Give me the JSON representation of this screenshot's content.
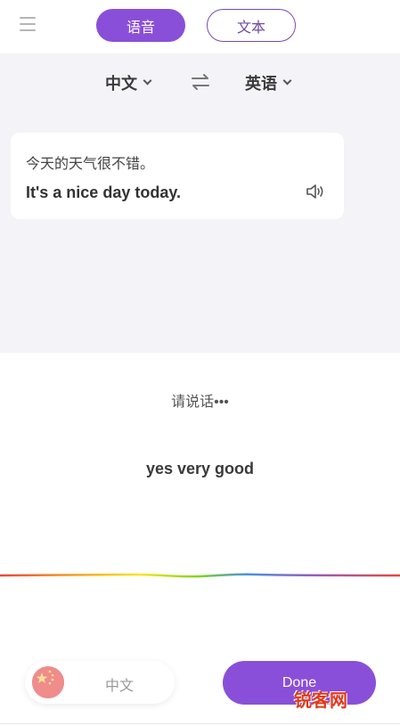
{
  "header": {
    "tabs": [
      {
        "label": "语音",
        "active": true
      },
      {
        "label": "文本",
        "active": false
      }
    ],
    "menu_icon": "hamburger-menu-icon"
  },
  "languages": {
    "source": "中文",
    "target": "英语",
    "swap_icon": "swap-arrows-icon"
  },
  "translation_card": {
    "source_text": "今天的天气很不错。",
    "translated_text": "It's a nice day today.",
    "speaker_icon": "speaker-icon"
  },
  "listening": {
    "prompt": "请说话•••",
    "recognized_text": "yes very good"
  },
  "bottom": {
    "language_label": "中文",
    "flag_icon": "china-flag-icon",
    "done_label": "Done"
  },
  "watermark": "锐客网",
  "colors": {
    "accent": "#8a4fd8",
    "upper_background": "#f4f3f8",
    "tab_outline": "#7a4bb0"
  }
}
